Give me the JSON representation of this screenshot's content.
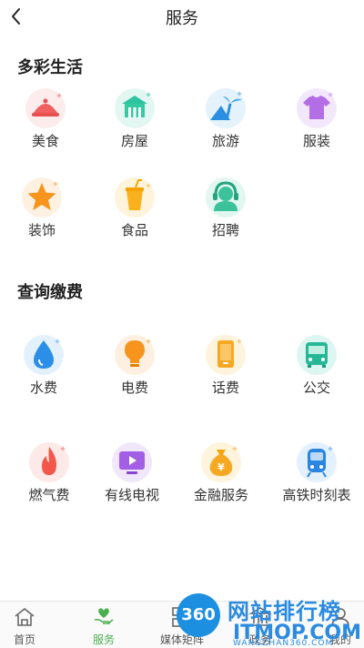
{
  "header": {
    "title": "服务"
  },
  "sections": [
    {
      "title": "多彩生活"
    },
    {
      "title": "查询缴费"
    }
  ],
  "life_items": [
    {
      "label": "美食"
    },
    {
      "label": "房屋"
    },
    {
      "label": "旅游"
    },
    {
      "label": "服装"
    },
    {
      "label": "装饰"
    },
    {
      "label": "食品"
    },
    {
      "label": "招聘"
    }
  ],
  "pay_items": [
    {
      "label": "水费"
    },
    {
      "label": "电费"
    },
    {
      "label": "话费"
    },
    {
      "label": "公交"
    },
    {
      "label": "燃气费"
    },
    {
      "label": "有线电视"
    },
    {
      "label": "金融服务"
    },
    {
      "label": "高铁时刻表"
    }
  ],
  "tabs": [
    {
      "label": "首页"
    },
    {
      "label": "服务"
    },
    {
      "label": "媒体矩阵"
    },
    {
      "label": "政务"
    },
    {
      "label": "我的"
    }
  ],
  "watermark": {
    "badge": "360",
    "line1": "网站排行榜",
    "line2": "ITMOP.COM",
    "line3": "WANGZHAN360.COM"
  },
  "colors": {
    "accent_green": "#4caf50",
    "watermark_blue": "#2b8be0"
  }
}
